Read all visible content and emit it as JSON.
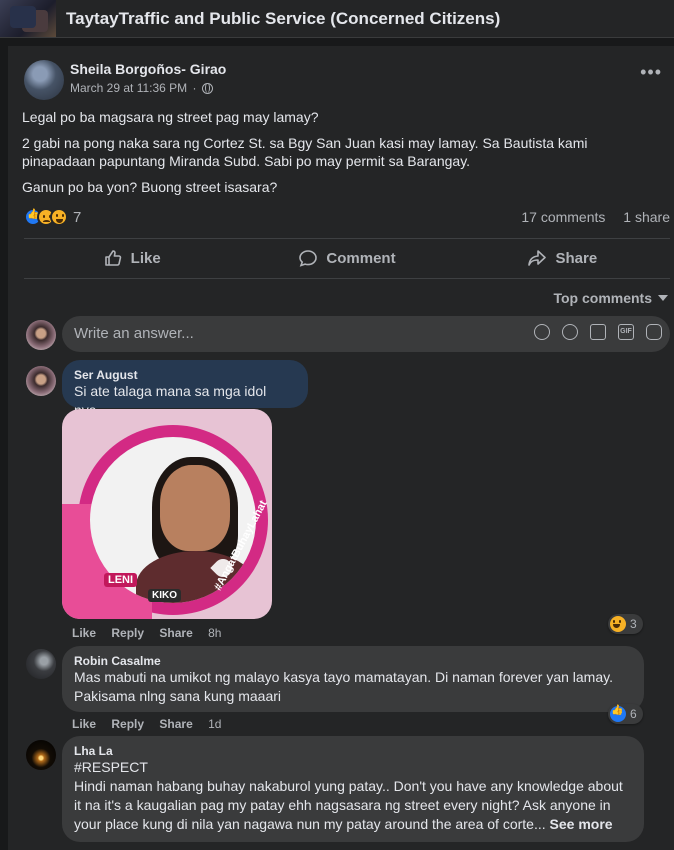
{
  "group": {
    "title": "TaytayTraffic and Public Service (Concerned Citizens)"
  },
  "post": {
    "author": "Sheila Borgoños- Girao",
    "date": "March 29 at 11:36 PM",
    "meta_sep": "·",
    "privacy_icon": "globe-icon",
    "more_label": "•••",
    "paragraphs": [
      "Legal po ba magsara ng street pag may lamay?",
      "2 gabi na pong naka sara ng Cortez St. sa Bgy San Juan kasi may lamay. Sa Bautista kami pinapadaan papuntang Miranda Subd. Sabi po may permit sa Barangay.",
      "Ganun po ba yon? Buong street isasara?"
    ],
    "reactions": {
      "types": [
        "like",
        "sad",
        "haha"
      ],
      "count": "7"
    },
    "comments_count": "17 comments",
    "shares_count": "1 share",
    "actions": {
      "like": "Like",
      "comment": "Comment",
      "share": "Share"
    }
  },
  "comments_header": {
    "sort_label": "Top comments"
  },
  "composer": {
    "placeholder": "Write an answer...",
    "icons": [
      "avatar-icon",
      "emoji-icon",
      "camera-icon",
      "gif-icon",
      "sticker-icon"
    ],
    "gif_label": "GIF"
  },
  "comments": [
    {
      "name": "Ser August",
      "text": "Si ate talaga mana sa mga idol nya...",
      "photo": {
        "badge_leni": "LENI",
        "badge_kiko": "KIKO",
        "hashtag": "#AngatBuhayLahat"
      },
      "like": "Like",
      "reply": "Reply",
      "share": "Share",
      "time": "8h",
      "reaction": {
        "type": "haha",
        "count": "3"
      }
    },
    {
      "name": "Robin Casalme",
      "text": "Mas mabuti na umikot ng malayo kasya tayo mamatayan. Di naman forever yan lamay. Pakisama nlng sana kung maaari",
      "like": "Like",
      "reply": "Reply",
      "share": "Share",
      "time": "1d",
      "reaction": {
        "type": "like",
        "count": "6"
      }
    },
    {
      "name": "Lha La",
      "text_line1": "#RESPECT",
      "text": "Hindi naman habang buhay nakaburol yung patay.. Don't you have any knowledge about it na it's a kaugalian pag my patay ehh nagsasara ng street every night? Ask anyone in your place kung di nila yan nagawa nun my patay around the area of corte...",
      "see_more": "See more"
    }
  ],
  "colors": {
    "bg": "#18191a",
    "card": "#242526",
    "bubble": "#3a3b3c",
    "highlight_bubble": "#263951",
    "like_blue": "#2078f4",
    "emoji_yellow": "#f7b125"
  }
}
